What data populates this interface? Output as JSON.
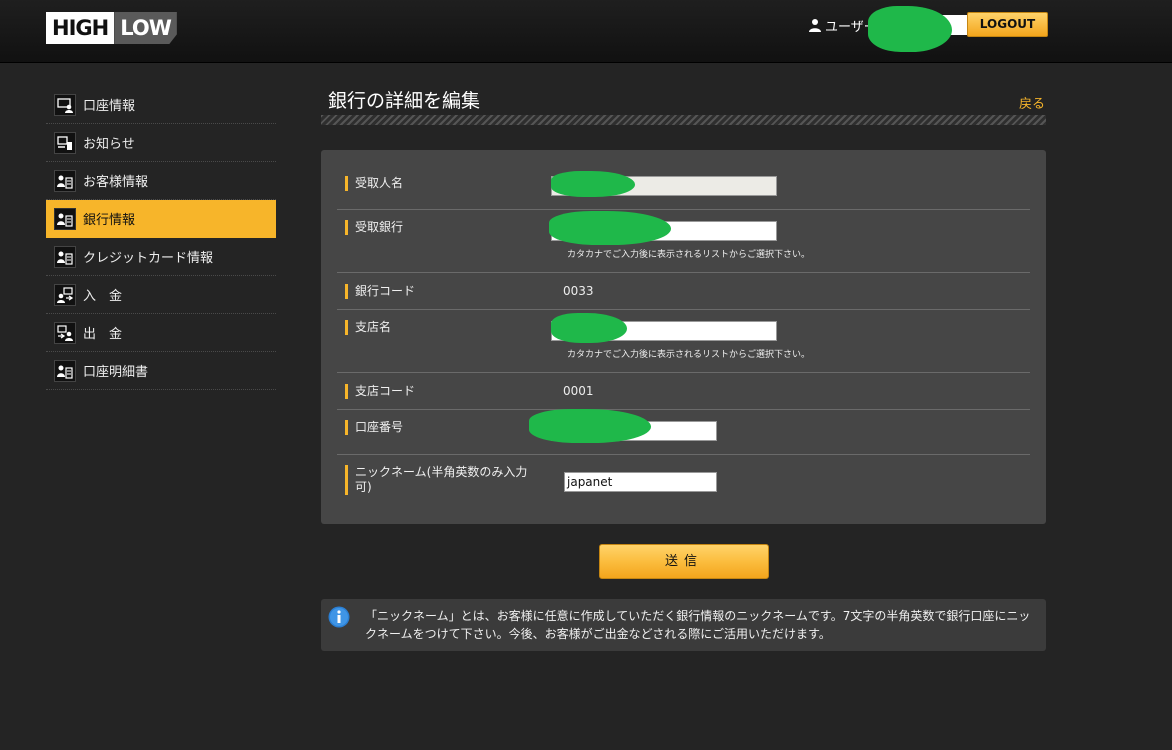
{
  "header": {
    "logo_left": "HIGH",
    "logo_right": "LOW",
    "user_label": "ユーザーID",
    "logout_label": "LOGOUT"
  },
  "sidebar": {
    "items": [
      {
        "label": "口座情報",
        "icon": "account-icon"
      },
      {
        "label": "お知らせ",
        "icon": "notice-icon"
      },
      {
        "label": "お客様情報",
        "icon": "customer-icon"
      },
      {
        "label": "銀行情報",
        "icon": "bank-icon",
        "active": true
      },
      {
        "label": "クレジットカード情報",
        "icon": "credit-card-icon"
      },
      {
        "label": "入　金",
        "icon": "deposit-icon"
      },
      {
        "label": "出　金",
        "icon": "withdraw-icon"
      },
      {
        "label": "口座明細書",
        "icon": "statement-icon"
      }
    ],
    "active_color": "#f7b52a"
  },
  "main": {
    "title": "銀行の詳細を編集",
    "back_label": "戻る",
    "form": {
      "recipient_name_label": "受取人名",
      "recipient_bank_label": "受取銀行",
      "recipient_bank_hint": "カタカナでご入力後に表示されるリストからご選択下さい。",
      "bank_code_label": "銀行コード",
      "bank_code_value": "0033",
      "branch_name_label": "支店名",
      "branch_name_hint": "カタカナでご入力後に表示されるリストからご選択下さい。",
      "branch_code_label": "支店コード",
      "branch_code_value": "0001",
      "account_number_label": "口座番号",
      "nickname_label_line1": "ニックネーム(半角英数のみ入力",
      "nickname_label_line2": "可)",
      "nickname_value": "japanet"
    },
    "submit_label": "送信",
    "info_text": "「ニックネーム」とは、お客様に任意に作成していただく銀行情報のニックネームです。7文字の半角英数で銀行口座にニックネームをつけて下さい。今後、お客様がご出金などされる際にご活用いただけます。"
  },
  "colors": {
    "accent": "#f7b52a",
    "background": "#242424",
    "panel": "#464646",
    "redaction": "#1fb84a"
  }
}
